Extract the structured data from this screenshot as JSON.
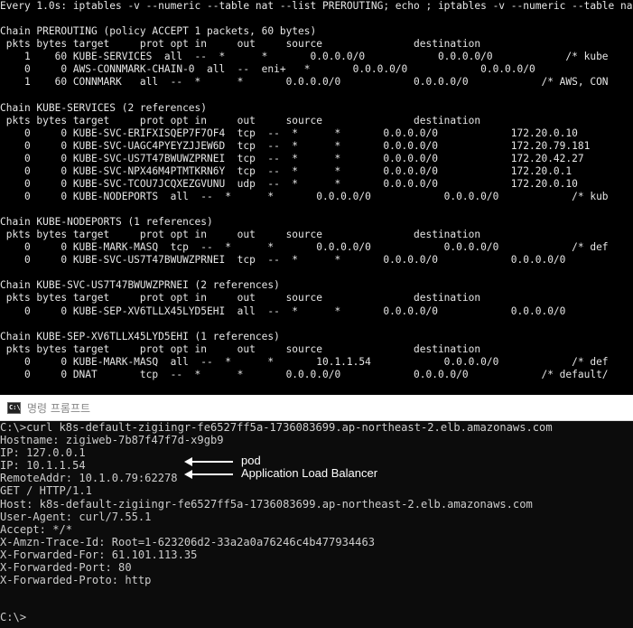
{
  "watch_terminal": {
    "text": "Every 1.0s: iptables -v --numeric --table nat --list PREROUTING; echo ; iptables -v --numeric --table nat --list\n\nChain PREROUTING (policy ACCEPT 1 packets, 60 bytes)\n pkts bytes target     prot opt in     out     source               destination\n    1    60 KUBE-SERVICES  all  --  *      *       0.0.0.0/0            0.0.0.0/0            /* kube\n    0     0 AWS-CONNMARK-CHAIN-0  all  --  eni+   *       0.0.0.0/0            0.0.0.0/0\n    1    60 CONNMARK   all  --  *      *       0.0.0.0/0            0.0.0.0/0            /* AWS, CON\n\nChain KUBE-SERVICES (2 references)\n pkts bytes target     prot opt in     out     source               destination\n    0     0 KUBE-SVC-ERIFXISQEP7F7OF4  tcp  --  *      *       0.0.0.0/0            172.20.0.10\n    0     0 KUBE-SVC-UAGC4PYEYZJJEW6D  tcp  --  *      *       0.0.0.0/0            172.20.79.181\n    0     0 KUBE-SVC-US7T47BWUWZPRNEI  tcp  --  *      *       0.0.0.0/0            172.20.42.27\n    0     0 KUBE-SVC-NPX46M4PTMTKRN6Y  tcp  --  *      *       0.0.0.0/0            172.20.0.1\n    0     0 KUBE-SVC-TCOU7JCQXEZGVUNU  udp  --  *      *       0.0.0.0/0            172.20.0.10\n    0     0 KUBE-NODEPORTS  all  --  *      *       0.0.0.0/0            0.0.0.0/0            /* kub\n\nChain KUBE-NODEPORTS (1 references)\n pkts bytes target     prot opt in     out     source               destination\n    0     0 KUBE-MARK-MASQ  tcp  --  *      *       0.0.0.0/0            0.0.0.0/0            /* def\n    0     0 KUBE-SVC-US7T47BWUWZPRNEI  tcp  --  *      *       0.0.0.0/0            0.0.0.0/0\n\nChain KUBE-SVC-US7T47BWUWZPRNEI (2 references)\n pkts bytes target     prot opt in     out     source               destination\n    0     0 KUBE-SEP-XV6TLLX45LYD5EHI  all  --  *      *       0.0.0.0/0            0.0.0.0/0\n\nChain KUBE-SEP-XV6TLLX45LYD5EHI (1 references)\n pkts bytes target     prot opt in     out     source               destination\n    0     0 KUBE-MARK-MASQ  all  --  *      *       10.1.1.54            0.0.0.0/0            /* def\n    0     0 DNAT       tcp  --  *      *       0.0.0.0/0            0.0.0.0/0            /* default/"
  },
  "cmd_window": {
    "title": "명령 프롬프트",
    "icon": "cmd-window-icon",
    "output": "C:\\>curl k8s-default-zigiingr-fe6527ff5a-1736083699.ap-northeast-2.elb.amazonaws.com\nHostname: zigiweb-7b87f47f7d-x9gb9\nIP: 127.0.0.1\nIP: 10.1.1.54\nRemoteAddr: 10.1.0.79:62278\nGET / HTTP/1.1\nHost: k8s-default-zigiingr-fe6527ff5a-1736083699.ap-northeast-2.elb.amazonaws.com\nUser-Agent: curl/7.55.1\nAccept: */*\nX-Amzn-Trace-Id: Root=1-623206d2-33a2a0a76246c4b477934463\nX-Forwarded-For: 61.101.113.35\nX-Forwarded-Port: 80\nX-Forwarded-Proto: http",
    "prompt": "C:\\>"
  },
  "annotations": {
    "pod_label": "pod",
    "alb_label": "Application Load Balancer"
  }
}
